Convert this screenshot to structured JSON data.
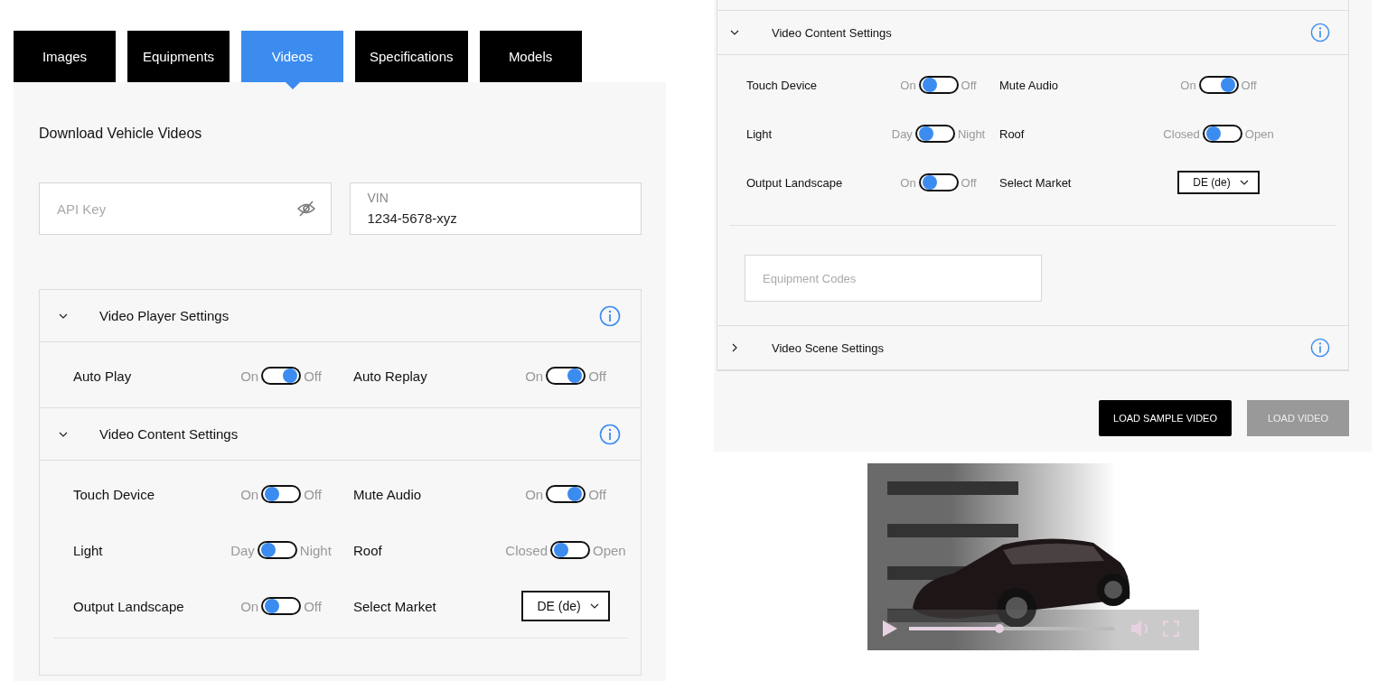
{
  "left_panel": {
    "tabs": [
      {
        "label": "Images",
        "selected": false
      },
      {
        "label": "Equipments",
        "selected": false
      },
      {
        "label": "Videos",
        "selected": true
      },
      {
        "label": "Specifications",
        "selected": false
      },
      {
        "label": "Models",
        "selected": false
      }
    ],
    "heading": "Download Vehicle Videos",
    "api_key": {
      "placeholder": "API Key"
    },
    "vin": {
      "label": "VIN",
      "value": "1234-5678-xyz"
    },
    "sections": [
      {
        "title": "Video Player Settings",
        "expanded": true,
        "items": [
          {
            "kind": "toggle",
            "label": "Auto Play",
            "left": "On",
            "right": "Off",
            "knob_right": true
          },
          {
            "kind": "toggle",
            "label": "Auto Replay",
            "left": "On",
            "right": "Off",
            "knob_right": true
          }
        ]
      },
      {
        "title": "Video Content Settings",
        "expanded": true,
        "items": [
          {
            "kind": "toggle",
            "label": "Touch Device",
            "left": "On",
            "right": "Off",
            "knob_right": false
          },
          {
            "kind": "toggle",
            "label": "Mute Audio",
            "left": "On",
            "right": "Off",
            "knob_right": true
          },
          {
            "kind": "toggle",
            "label": "Light",
            "left": "Day",
            "right": "Night",
            "knob_right": false
          },
          {
            "kind": "toggle",
            "label": "Roof",
            "left": "Closed",
            "right": "Open",
            "knob_right": false
          },
          {
            "kind": "toggle",
            "label": "Output Landscape",
            "left": "On",
            "right": "Off",
            "knob_right": false
          },
          {
            "kind": "select",
            "label": "Select Market",
            "value": "DE (de)"
          }
        ]
      }
    ]
  },
  "right_panel": {
    "sections": [
      {
        "title": "Video Content Settings",
        "expanded": true,
        "items": [
          {
            "kind": "toggle",
            "label": "Touch Device",
            "left": "On",
            "right": "Off",
            "knob_right": false
          },
          {
            "kind": "toggle",
            "label": "Mute Audio",
            "left": "On",
            "right": "Off",
            "knob_right": true
          },
          {
            "kind": "toggle",
            "label": "Light",
            "left": "Day",
            "right": "Night",
            "knob_right": false
          },
          {
            "kind": "toggle",
            "label": "Roof",
            "left": "Closed",
            "right": "Open",
            "knob_right": false
          },
          {
            "kind": "toggle",
            "label": "Output Landscape",
            "left": "On",
            "right": "Off",
            "knob_right": false
          },
          {
            "kind": "select",
            "label": "Select Market",
            "value": "DE (de)"
          }
        ],
        "equipment": {
          "placeholder": "Equipment Codes"
        }
      },
      {
        "title": "Video Scene Settings",
        "expanded": false
      }
    ],
    "buttons": [
      {
        "label": "LOAD SAMPLE VIDEO",
        "disabled": false
      },
      {
        "label": "LOAD VIDEO",
        "disabled": true
      }
    ]
  },
  "video": {
    "kind": "picture",
    "progress": {
      "level": 0.44
    }
  }
}
